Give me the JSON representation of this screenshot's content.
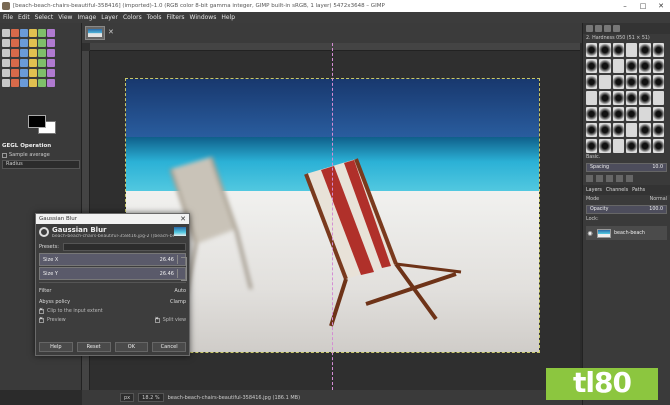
{
  "window": {
    "title": "[beach-beach-chairs-beautiful-358416] (imported)-1.0 (RGB color 8-bit gamma integer, GIMP built-in sRGB, 1 layer) 5472x3648 – GIMP",
    "minimize": "–",
    "maximize": "□",
    "close": "✕"
  },
  "menu": [
    "File",
    "Edit",
    "Select",
    "View",
    "Image",
    "Layer",
    "Colors",
    "Tools",
    "Filters",
    "Windows",
    "Help"
  ],
  "tool_options": {
    "title": "GEGL Operation",
    "sample_average": "Sample average",
    "radius_label": "Radius"
  },
  "tab": {
    "close": "✕"
  },
  "dialog": {
    "window_title": "Gaussian Blur",
    "close": "✕",
    "heading": "Gaussian Blur",
    "subtitle": "beach-beach-chairs-beautiful-358416.jpg-2 ([beach-bea...",
    "presets_label": "Presets:",
    "size_x_label": "Size X",
    "size_x_value": "26.46",
    "size_y_label": "Size Y",
    "size_y_value": "26.46",
    "filter_label": "Filter",
    "filter_value": "Auto",
    "abyss_label": "Abyss policy",
    "abyss_value": "Clamp",
    "clip_label": "Clip to the input extent",
    "preview_label": "Preview",
    "split_label": "Split view",
    "buttons": {
      "help": "Help",
      "reset": "Reset",
      "ok": "OK",
      "cancel": "Cancel"
    }
  },
  "statusbar": {
    "unit": "px",
    "zoom": "18.2 %",
    "info": "beach-beach-chairs-beautiful-358416.jpg (186.1 MB)"
  },
  "brand": "tl80",
  "right_panel": {
    "brush_name": "2. Hardness 050 (51 × 51)",
    "brush_tag": "Basic.",
    "spacing_label": "Spacing",
    "spacing_value": "10.0",
    "layer_tabs": [
      "Layers",
      "Channels",
      "Paths"
    ],
    "mode_label": "Mode",
    "mode_value": "Normal",
    "opacity_label": "Opacity",
    "opacity_value": "100.0",
    "lock_label": "Lock:",
    "layer_name": "beach-beach"
  },
  "colors": {
    "accent_brand": "#8cc63f",
    "split_line": "#d48cd4"
  }
}
